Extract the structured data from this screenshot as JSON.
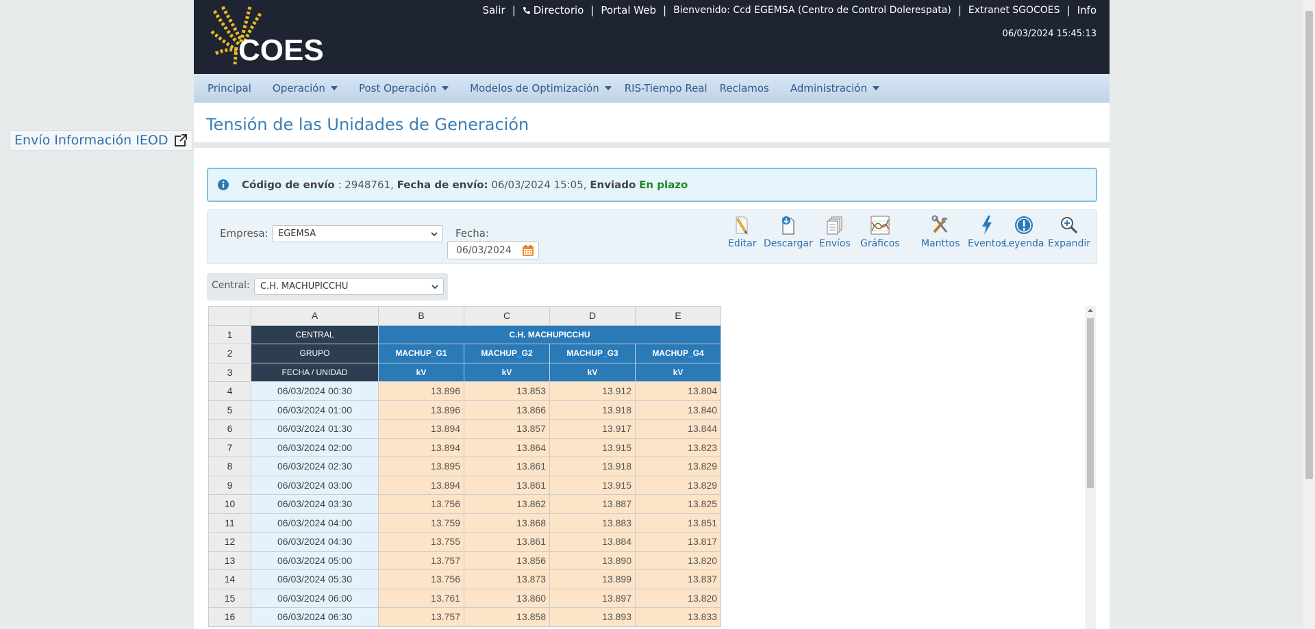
{
  "side_link": {
    "label": "Envío Información IEOD",
    "icon": "external-link-icon"
  },
  "header": {
    "logo_text": "COES",
    "links": {
      "salir": "Salir",
      "directorio": "Directorio",
      "portal": "Portal Web",
      "welcome": "Bienvenido: Ccd EGEMSA (Centro de Control Dolerespata)",
      "extranet": "Extranet SGOCOES",
      "info": "Info"
    },
    "separator": "|",
    "datetime": "06/03/2024 15:45:13"
  },
  "menu": [
    {
      "label": "Principal",
      "has_caret": false
    },
    {
      "label": "Operación",
      "has_caret": true
    },
    {
      "label": "Post Operación",
      "has_caret": true
    },
    {
      "label": "Modelos de Optimización",
      "has_caret": true
    },
    {
      "label": "RIS-Tiempo Real",
      "has_caret": false
    },
    {
      "label": "Reclamos",
      "has_caret": false
    },
    {
      "label": "Administración",
      "has_caret": true
    }
  ],
  "page_title": "Tensión de las Unidades de Generación",
  "alert": {
    "codigo_label": "Código de envío",
    "codigo_value": " : 2948761, ",
    "fecha_label": "Fecha de envío:",
    "fecha_value": " 06/03/2024 15:05, ",
    "enviado_label": "Enviado",
    "status": "En plazo"
  },
  "filters": {
    "empresa_label": "Empresa:",
    "empresa_value": "EGEMSA",
    "fecha_label": "Fecha:",
    "fecha_value": "06/03/2024",
    "central_label": "Central:",
    "central_value": "C.H. MACHUPICCHU"
  },
  "tools": [
    "Editar",
    "Descargar",
    "Envíos",
    "Gráficos",
    "Manttos",
    "Eventos",
    "Leyenda",
    "Expandir"
  ],
  "grid": {
    "col_headers": [
      "A",
      "B",
      "C",
      "D",
      "E"
    ],
    "row1_label": "CENTRAL",
    "central_name": "C.H. MACHUPICCHU",
    "row2_label": "GRUPO",
    "grupos": [
      "MACHUP_G1",
      "MACHUP_G2",
      "MACHUP_G3",
      "MACHUP_G4"
    ],
    "row3_label": "FECHA / UNIDAD",
    "units": [
      "kV",
      "kV",
      "kV",
      "kV"
    ],
    "rows": [
      {
        "n": "4",
        "date": "06/03/2024 00:30",
        "v": [
          "13.896",
          "13.853",
          "13.912",
          "13.804"
        ]
      },
      {
        "n": "5",
        "date": "06/03/2024 01:00",
        "v": [
          "13.896",
          "13.866",
          "13.918",
          "13.840"
        ]
      },
      {
        "n": "6",
        "date": "06/03/2024 01:30",
        "v": [
          "13.894",
          "13.857",
          "13.917",
          "13.844"
        ]
      },
      {
        "n": "7",
        "date": "06/03/2024 02:00",
        "v": [
          "13.894",
          "13.864",
          "13.915",
          "13.823"
        ]
      },
      {
        "n": "8",
        "date": "06/03/2024 02:30",
        "v": [
          "13.895",
          "13.861",
          "13.918",
          "13.829"
        ]
      },
      {
        "n": "9",
        "date": "06/03/2024 03:00",
        "v": [
          "13.894",
          "13.861",
          "13.915",
          "13.829"
        ]
      },
      {
        "n": "10",
        "date": "06/03/2024 03:30",
        "v": [
          "13.756",
          "13.862",
          "13.887",
          "13.825"
        ]
      },
      {
        "n": "11",
        "date": "06/03/2024 04:00",
        "v": [
          "13.759",
          "13.868",
          "13.883",
          "13.851"
        ]
      },
      {
        "n": "12",
        "date": "06/03/2024 04:30",
        "v": [
          "13.755",
          "13.861",
          "13.884",
          "13.817"
        ]
      },
      {
        "n": "13",
        "date": "06/03/2024 05:00",
        "v": [
          "13.757",
          "13.856",
          "13.890",
          "13.820"
        ]
      },
      {
        "n": "14",
        "date": "06/03/2024 05:30",
        "v": [
          "13.756",
          "13.873",
          "13.899",
          "13.837"
        ]
      },
      {
        "n": "15",
        "date": "06/03/2024 06:00",
        "v": [
          "13.761",
          "13.860",
          "13.897",
          "13.820"
        ]
      },
      {
        "n": "16",
        "date": "06/03/2024 06:30",
        "v": [
          "13.757",
          "13.858",
          "13.893",
          "13.833"
        ]
      }
    ]
  }
}
